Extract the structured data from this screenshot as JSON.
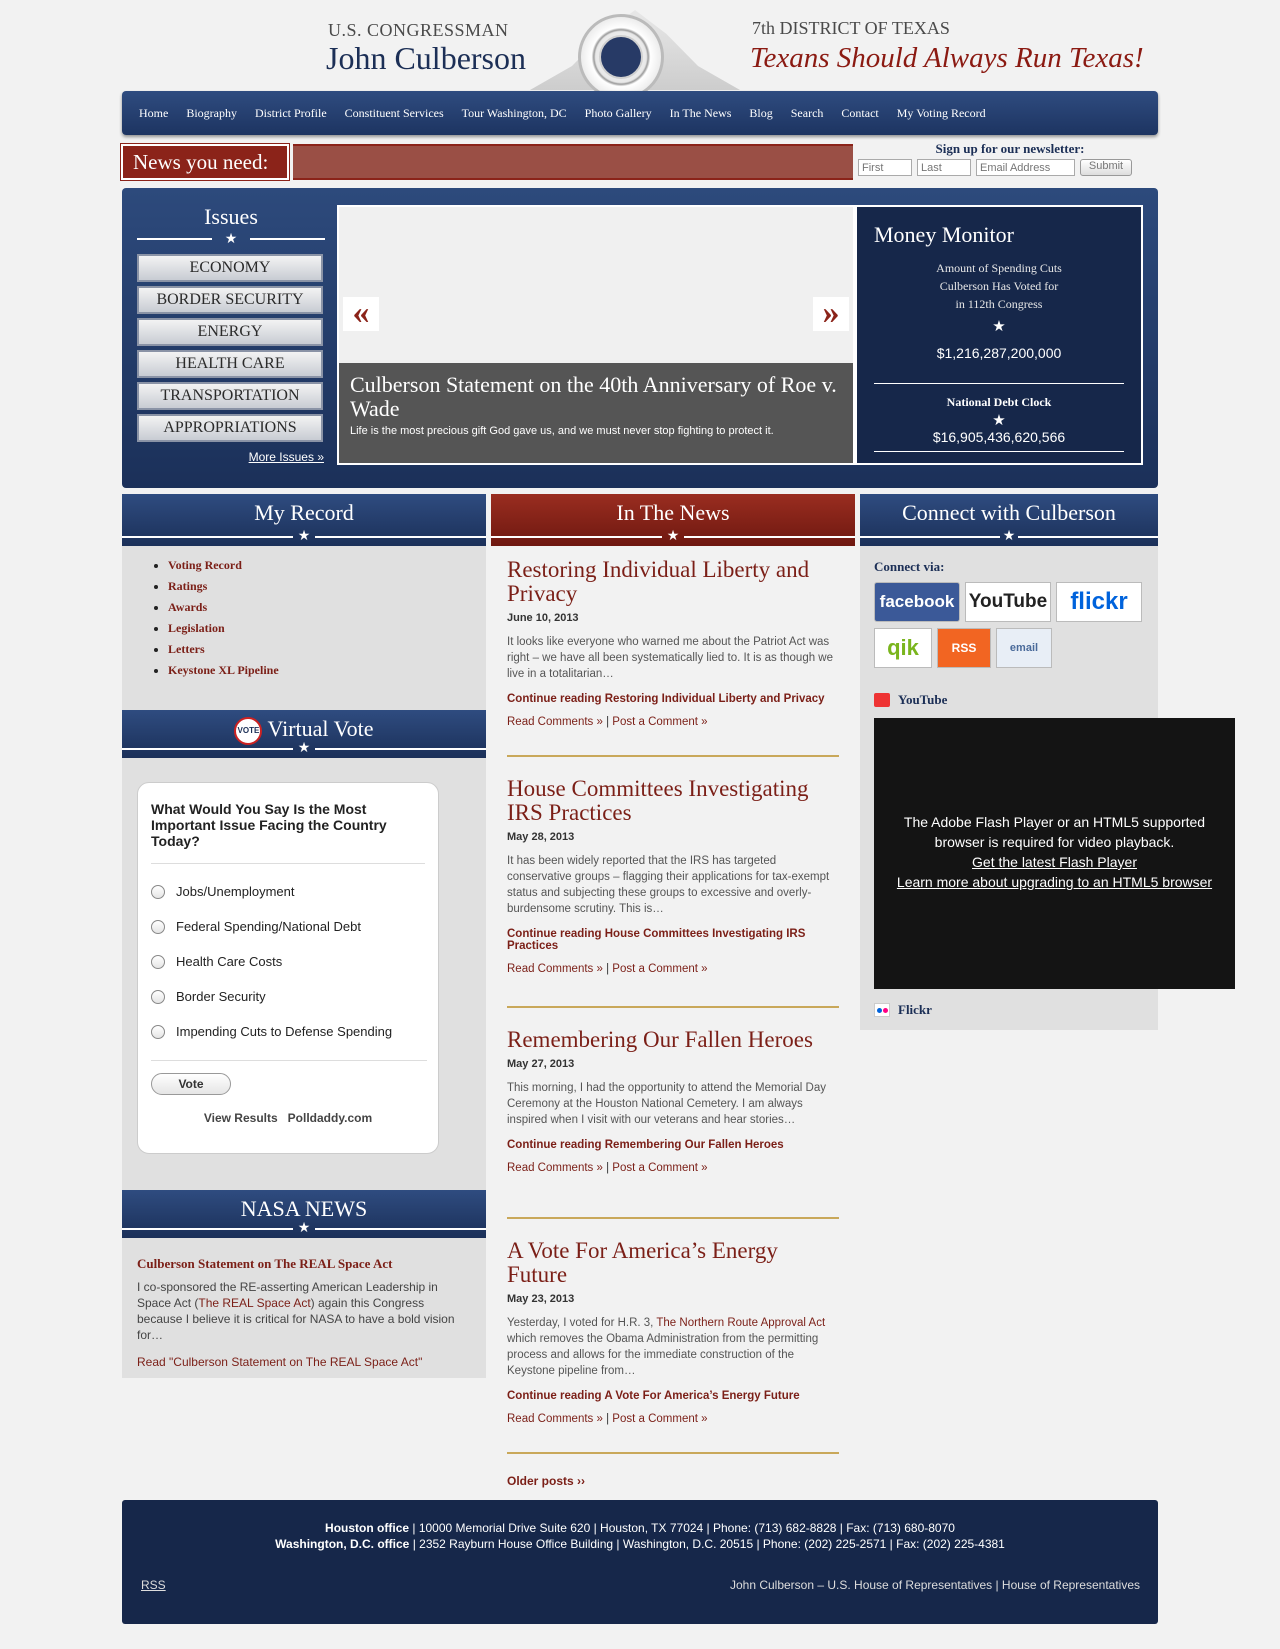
{
  "header": {
    "left_small": "U.S. CONGRESSMAN",
    "left_big": "John Culberson",
    "right_small": "7th DISTRICT OF TEXAS",
    "right_big": "Texans Should Always Run Texas!"
  },
  "nav": [
    "Home",
    "Biography",
    "District Profile",
    "Constituent Services",
    "Tour Washington, DC",
    "Photo Gallery",
    "In The News",
    "Blog",
    "Search",
    "Contact",
    "My Voting Record"
  ],
  "news_bar": {
    "label": "News you need:"
  },
  "newsletter": {
    "title": "Sign up for our newsletter:",
    "first_placeholder": "First",
    "last_placeholder": "Last",
    "email_placeholder": "Email Address",
    "submit": "Submit"
  },
  "issues": {
    "title": "Issues",
    "items": [
      "ECONOMY",
      "BORDER SECURITY",
      "ENERGY",
      "HEALTH CARE",
      "TRANSPORTATION",
      "APPROPRIATIONS"
    ],
    "more": "More Issues »"
  },
  "slider": {
    "prev": "«",
    "next": "»",
    "title": "Culberson Statement on the 40th Anniversary of Roe v. Wade",
    "text": "Life is the most precious gift God gave us, and we must never stop fighting to protect it."
  },
  "money_monitor": {
    "title": "Money Monitor",
    "subtitle_lines": [
      "Amount of Spending Cuts",
      "Culberson Has Voted for",
      "in 112th Congress"
    ],
    "spending_cuts": "$1,216,287,200,000",
    "debt_title": "National Debt Clock",
    "debt_value": "$16,905,436,620,566",
    "star": "★"
  },
  "my_record": {
    "title": "My Record",
    "items": [
      "Voting Record",
      "Ratings",
      "Awards",
      "Legislation",
      "Letters",
      "Keystone XL Pipeline"
    ]
  },
  "virtual_vote": {
    "title": "Virtual Vote",
    "badge": "VOTE",
    "question": "What Would You Say Is the Most Important Issue Facing the Country Today?",
    "options": [
      "Jobs/Unemployment",
      "Federal Spending/National Debt",
      "Health Care Costs",
      "Border Security",
      "Impending Cuts to Defense Spending"
    ],
    "vote_button": "Vote",
    "view_results": "View Results",
    "provider": "Polldaddy.com"
  },
  "nasa_news": {
    "title": "NASA NEWS",
    "link": "Culberson Statement on The REAL Space Act",
    "text_before": "I co-sponsored the RE-asserting American Leadership in Space Act (",
    "text_link": "The REAL Space Act",
    "text_after": ") again this Congress because I believe it is critical for NASA to have a bold vision for…",
    "read_more": "Read \"Culberson Statement on The REAL Space Act\""
  },
  "in_the_news": {
    "title": "In The News",
    "posts": [
      {
        "title": "Restoring Individual Liberty and Privacy",
        "date": "June 10, 2013",
        "body": "It looks like everyone who warned me about the Patriot Act was right – we have all been systematically lied to.  It is as though we live in a totalitarian…",
        "continue": "Continue reading Restoring Individual Liberty and Privacy"
      },
      {
        "title": "House Committees Investigating IRS Practices",
        "date": "May 28, 2013",
        "body": "It has been widely reported that the IRS has targeted conservative groups – flagging their applications for tax-exempt status and subjecting these groups to excessive and overly-burdensome scrutiny.  This is…",
        "continue": "Continue reading House Committees Investigating IRS Practices"
      },
      {
        "title": "Remembering Our Fallen Heroes",
        "date": "May 27, 2013",
        "body": "This morning, I had the opportunity to attend the Memorial Day Ceremony at the Houston National Cemetery. I am always inspired when I visit with our veterans and hear stories…",
        "continue": "Continue reading Remembering Our Fallen Heroes"
      },
      {
        "title": "A Vote For America’s Energy Future",
        "date": "May 23, 2013",
        "body_before": "Yesterday, I voted for H.R. 3, ",
        "body_link": "The Northern Route Approval Act",
        "body_after": " which removes the Obama Administration from the permitting process and allows for the immediate construction of the Keystone pipeline from…",
        "continue": "Continue reading A Vote For America’s Energy Future"
      }
    ],
    "read_comments": "Read Comments »",
    "separator": "|",
    "post_comment": "Post a Comment »",
    "older": "Older posts ››"
  },
  "connect": {
    "title": "Connect with Culberson",
    "via": "Connect via:",
    "networks": [
      "facebook",
      "YouTube",
      "flickr",
      "qik",
      "RSS",
      "email"
    ],
    "youtube_label": "YouTube",
    "flash_line1": "The Adobe Flash Player or an HTML5 supported",
    "flash_line2": "browser is required for video playback.",
    "flash_link1": "Get the latest Flash Player",
    "flash_link2": "Learn more about upgrading to an HTML5 browser",
    "flickr_label": "Flickr"
  },
  "footer": {
    "houston_label": "Houston office",
    "houston_info": " | 10000 Memorial Drive Suite 620 | Houston, TX 77024 | Phone: (713) 682-8828 | Fax: (713) 680-8070",
    "dc_label": "Washington, D.C. office",
    "dc_info": " | 2352 Rayburn House Office Building | Washington, D.C. 20515 | Phone: (202) 225-2571 | Fax: (202) 225-4381",
    "rss": "RSS",
    "link1": "John Culberson – U.S. House of Representatives",
    "sep": " | ",
    "link2": "House of Representatives"
  },
  "colors": {
    "navy": "#1c2f56",
    "crimson": "#8b2319",
    "gold_rule": "#c9a85a"
  }
}
